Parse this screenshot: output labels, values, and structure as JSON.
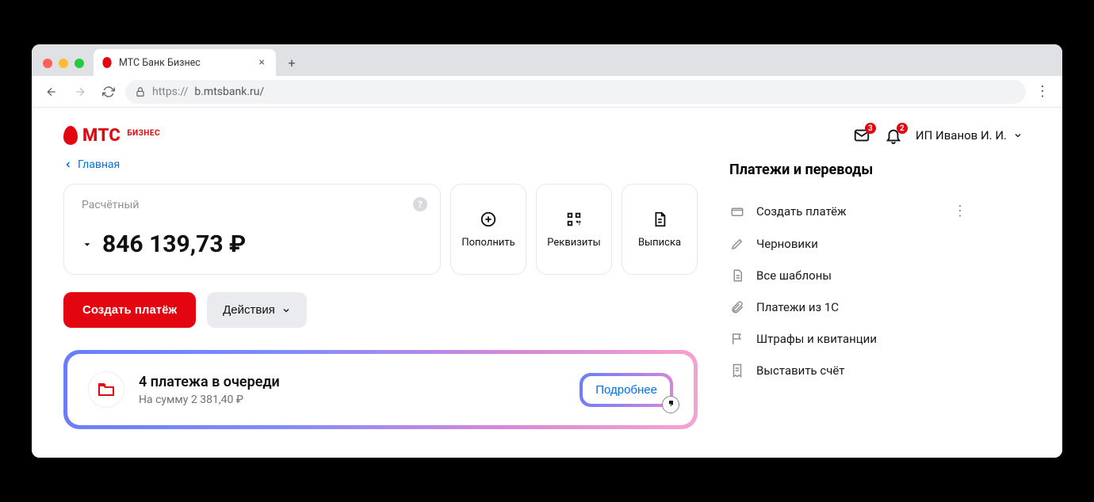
{
  "browser": {
    "tab_title": "МТС Банк Бизнес",
    "url_scheme": "https://",
    "url_host": "b.mtsbank.ru/"
  },
  "brand": {
    "name": "МТС",
    "suffix": "БИЗНЕС"
  },
  "header": {
    "mail_badge": "3",
    "bell_badge": "2",
    "user_name": "ИП Иванов И. И."
  },
  "breadcrumb": {
    "label": "Главная"
  },
  "account": {
    "label": "Расчётный",
    "balance": "846 139,73 ₽"
  },
  "tiles": {
    "topup": "Пополнить",
    "requisites": "Реквизиты",
    "statement": "Выписка"
  },
  "buttons": {
    "create_payment": "Создать платёж",
    "actions": "Действия"
  },
  "queue": {
    "title": "4 платежа в очереди",
    "subtitle": "На сумму 2 381,40 ₽",
    "details": "Подробнее"
  },
  "sidebar": {
    "title": "Платежи и переводы",
    "items": [
      "Создать платёж",
      "Черновики",
      "Все шаблоны",
      "Платежи из 1С",
      "Штрафы и квитанции",
      "Выставить счёт"
    ]
  }
}
